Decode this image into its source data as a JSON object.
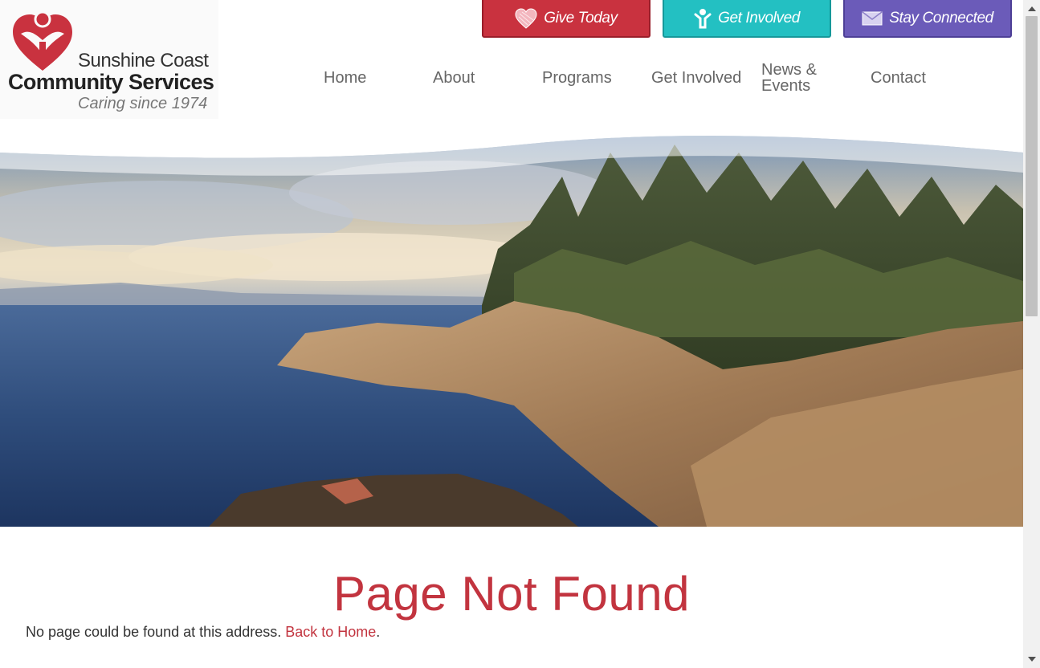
{
  "logo": {
    "line1": "Sunshine Coast",
    "line2": "Community Services",
    "tagline": "Caring since 1974"
  },
  "cta": {
    "give": {
      "label": "Give Today",
      "icon": "heart-icon",
      "color": "#c9323f"
    },
    "involved": {
      "label": "Get Involved",
      "icon": "person-icon",
      "color": "#23c0c2"
    },
    "connected": {
      "label": "Stay Connected",
      "icon": "envelope-icon",
      "color": "#6b5bb9"
    }
  },
  "nav": {
    "items": [
      {
        "label": "Home"
      },
      {
        "label": "About"
      },
      {
        "label": "Programs"
      },
      {
        "label": "Get Involved"
      },
      {
        "label": "News & Events"
      },
      {
        "label": "Contact"
      }
    ]
  },
  "main": {
    "title": "Page Not Found",
    "message": "No page could be found at this address.",
    "link": "Back to Home",
    "link_suffix": "."
  },
  "colors": {
    "accent": "#c2343f",
    "nav_text": "#666666"
  }
}
